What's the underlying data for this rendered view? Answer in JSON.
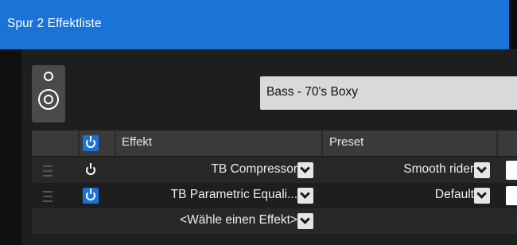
{
  "window": {
    "title": "Spur 2 Effektliste"
  },
  "preset_selector": {
    "value": "Bass - 70's Boxy"
  },
  "table": {
    "headers": {
      "effect": "Effekt",
      "preset": "Preset"
    },
    "rows": [
      {
        "effect": "TB Compressor",
        "preset": "Smooth rider",
        "enabled": false
      },
      {
        "effect": "TB Parametric Equali...",
        "preset": "Default",
        "enabled": true
      },
      {
        "effect": "<Wähle einen Effekt>",
        "preset": "",
        "enabled": false
      }
    ]
  },
  "icons": [
    "speaker-icon",
    "power-icon",
    "drag-handle-icon",
    "chevron-down-icon"
  ],
  "colors": {
    "accent": "#1a73d6",
    "background": "#1e1e1e",
    "header": "#3a3a3a"
  }
}
